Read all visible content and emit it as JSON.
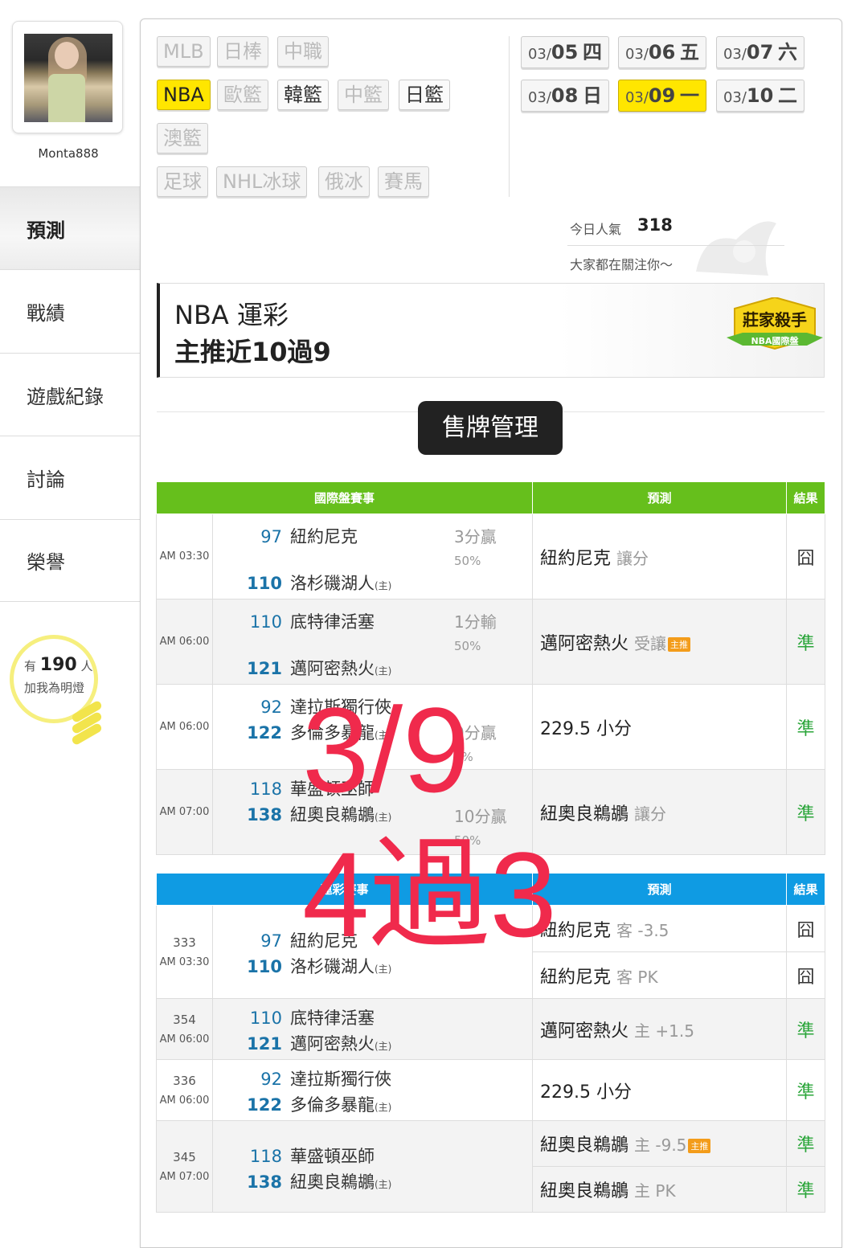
{
  "sidebar": {
    "username": "Monta888",
    "menu": [
      "預測",
      "戰績",
      "遊戲紀錄",
      "討論",
      "榮譽"
    ],
    "active_index": 0,
    "fans": {
      "prefix": "有",
      "count": "190",
      "suffix": "人",
      "label": "加我為明燈"
    }
  },
  "leagues": [
    {
      "label": "MLB",
      "state": "disabled"
    },
    {
      "label": "日棒",
      "state": "disabled"
    },
    {
      "label": "中職",
      "state": "disabled"
    },
    {
      "label": "NBA",
      "state": "selected"
    },
    {
      "label": "歐籃",
      "state": "disabled"
    },
    {
      "label": "韓籃",
      "state": "enabled"
    },
    {
      "label": "中籃",
      "state": "disabled"
    },
    {
      "label": "日籃",
      "state": "enabled"
    },
    {
      "label": "澳籃",
      "state": "disabled"
    },
    {
      "label": "足球",
      "state": "disabled"
    },
    {
      "label": "NHL冰球",
      "state": "disabled"
    },
    {
      "label": "俄冰",
      "state": "disabled"
    },
    {
      "label": "賽馬",
      "state": "disabled"
    }
  ],
  "dates": [
    {
      "md": "03/",
      "d": "05",
      "wd": "四"
    },
    {
      "md": "03/",
      "d": "06",
      "wd": "五"
    },
    {
      "md": "03/",
      "d": "07",
      "wd": "六"
    },
    {
      "md": "03/",
      "d": "08",
      "wd": "日"
    },
    {
      "md": "03/",
      "d": "09",
      "wd": "一",
      "selected": true
    },
    {
      "md": "03/",
      "d": "10",
      "wd": "二"
    }
  ],
  "popularity": {
    "label": "今日人氣",
    "count": "318",
    "sub": "大家都在關注你〜"
  },
  "banner": {
    "title": "NBA 運彩",
    "subtitle": "主推近10過9",
    "badge_top": "莊家殺手",
    "badge_bottom": "NBA國際盤"
  },
  "sell_button": "售牌管理",
  "intl_table": {
    "headers": [
      "國際盤賽事",
      "預測",
      "結果"
    ],
    "rows": [
      {
        "time": "AM 03:30",
        "s1": "97",
        "t1": "紐約尼克",
        "s2": "110",
        "t2": "洛杉磯湖人",
        "home": "(主)",
        "sp1": "3分贏",
        "sp2": "50%",
        "pred": "紐約尼克",
        "pred_note": "讓分",
        "tag": "",
        "result": "囧"
      },
      {
        "time": "AM 06:00",
        "s1": "110",
        "t1": "底特律活塞",
        "s2": "121",
        "t2": "邁阿密熱火",
        "home": "(主)",
        "sp1": "1分輸",
        "sp2": "50%",
        "pred": "邁阿密熱火",
        "pred_note": "受讓",
        "tag": "主推",
        "result": "準"
      },
      {
        "time": "AM 06:00",
        "s1": "92",
        "t1": "達拉斯獨行俠",
        "s2": "122",
        "t2": "多倫多暴龍",
        "home": "(主)",
        "sp1": "0分贏",
        "sp2": "0%",
        "pred": "229.5 小分",
        "pred_note": "",
        "tag": "",
        "result": "準"
      },
      {
        "time": "AM 07:00",
        "s1": "118",
        "t1": "華盛頓巫師",
        "s2": "138",
        "t2": "紐奧良鵜鶘",
        "home": "(主)",
        "sp1": "10分贏",
        "sp2": "50%",
        "pred": "紐奧良鵜鶘",
        "pred_note": "讓分",
        "tag": "",
        "result": "準"
      }
    ]
  },
  "sport_table": {
    "headers": [
      "運彩賽事",
      "預測",
      "結果"
    ],
    "rows": [
      {
        "gid": "333",
        "time": "AM 03:30",
        "s1": "97",
        "t1": "紐約尼克",
        "s2": "110",
        "t2": "洛杉磯湖人",
        "home": "(主)",
        "preds": [
          {
            "text": "紐約尼克",
            "note": "客 -3.5",
            "tag": "",
            "result": "囧"
          },
          {
            "text": "紐約尼克",
            "note": "客 PK",
            "tag": "",
            "result": "囧"
          }
        ]
      },
      {
        "gid": "354",
        "time": "AM 06:00",
        "s1": "110",
        "t1": "底特律活塞",
        "s2": "121",
        "t2": "邁阿密熱火",
        "home": "(主)",
        "preds": [
          {
            "text": "邁阿密熱火",
            "note": "主 +1.5",
            "tag": "",
            "result": "準"
          }
        ]
      },
      {
        "gid": "336",
        "time": "AM 06:00",
        "s1": "92",
        "t1": "達拉斯獨行俠",
        "s2": "122",
        "t2": "多倫多暴龍",
        "home": "(主)",
        "preds": [
          {
            "text": "229.5 小分",
            "note": "",
            "tag": "",
            "result": "準"
          }
        ]
      },
      {
        "gid": "345",
        "time": "AM 07:00",
        "s1": "118",
        "t1": "華盛頓巫師",
        "s2": "138",
        "t2": "紐奧良鵜鶘",
        "home": "(主)",
        "preds": [
          {
            "text": "紐奧良鵜鶘",
            "note": "主 -9.5",
            "tag": "主推",
            "result": "準"
          },
          {
            "text": "紐奧良鵜鶘",
            "note": "主 PK",
            "tag": "",
            "result": "準"
          }
        ]
      }
    ]
  },
  "overlay": {
    "line1": "3/9",
    "line2": "4過3",
    "color": "#f02a4c"
  },
  "colors": {
    "intl_header": "#66bf1c",
    "sport_header": "#0f9be3",
    "selected": "#ffe600",
    "correct": "#2aa539"
  }
}
